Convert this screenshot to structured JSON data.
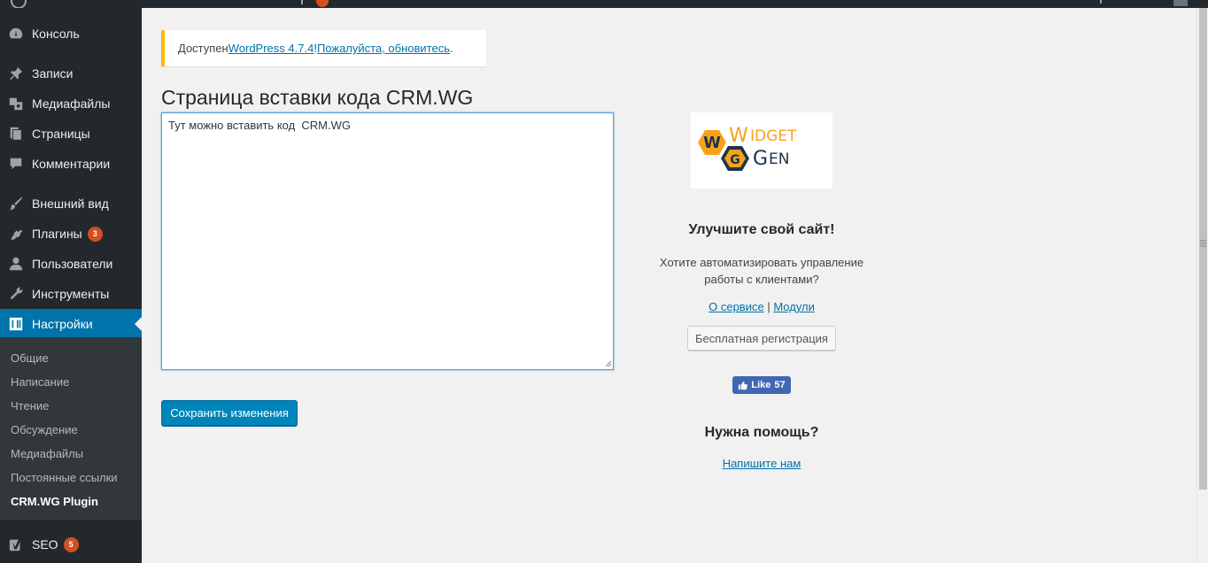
{
  "sidebar": {
    "items": [
      {
        "label": "Консоль",
        "icon": "dashboard-icon"
      },
      {
        "label": "Записи",
        "icon": "pin-icon"
      },
      {
        "label": "Медиафайлы",
        "icon": "media-icon"
      },
      {
        "label": "Страницы",
        "icon": "pages-icon"
      },
      {
        "label": "Комментарии",
        "icon": "comment-icon"
      },
      {
        "label": "Внешний вид",
        "icon": "brush-icon"
      },
      {
        "label": "Плагины",
        "icon": "plugin-icon",
        "badge": "3"
      },
      {
        "label": "Пользователи",
        "icon": "user-icon"
      },
      {
        "label": "Инструменты",
        "icon": "wrench-icon"
      },
      {
        "label": "Настройки",
        "icon": "settings-icon",
        "active": true
      },
      {
        "label": "SEO",
        "icon": "yoast-icon",
        "badge": "5"
      }
    ],
    "submenu": [
      "Общие",
      "Написание",
      "Чтение",
      "Обсуждение",
      "Медиафайлы",
      "Постоянные ссылки",
      "CRM.WG Plugin"
    ],
    "submenu_current": "CRM.WG Plugin"
  },
  "notice": {
    "prefix": "Доступен ",
    "version_link": "WordPress 4.7.4",
    "exclaim": "! ",
    "update_link": "Пожалуйста, обновитесь",
    "suffix": "."
  },
  "page": {
    "title": "Страница вставки кода CRM.WG",
    "textarea_value": "Тут можно вставить код  CRM.WG",
    "save_label": "Сохранить изменения"
  },
  "promo": {
    "logo_line1": "IDGET",
    "logo_line2": "EN",
    "logo_w": "W",
    "logo_g": "G",
    "logo_big_w": "W",
    "logo_big_g": "G",
    "heading": "Улучшите свой сайт!",
    "text_line1": "Хотите автоматизировать управление",
    "text_line2": "работы с клиентами?",
    "link_about": "О сервисе",
    "separator": " | ",
    "link_modules": "Модули",
    "register_label": "Бесплатная регистрация",
    "like_label": "Like",
    "like_count": "57",
    "help_heading": "Нужна помощь?",
    "help_link": "Напишите нам"
  },
  "colors": {
    "sidebar_bg": "#23282d",
    "accent": "#0073aa",
    "badge": "#d54e21",
    "notice_border": "#ffb900",
    "logo_orange": "#f7a21b",
    "logo_dark": "#1d3349"
  }
}
